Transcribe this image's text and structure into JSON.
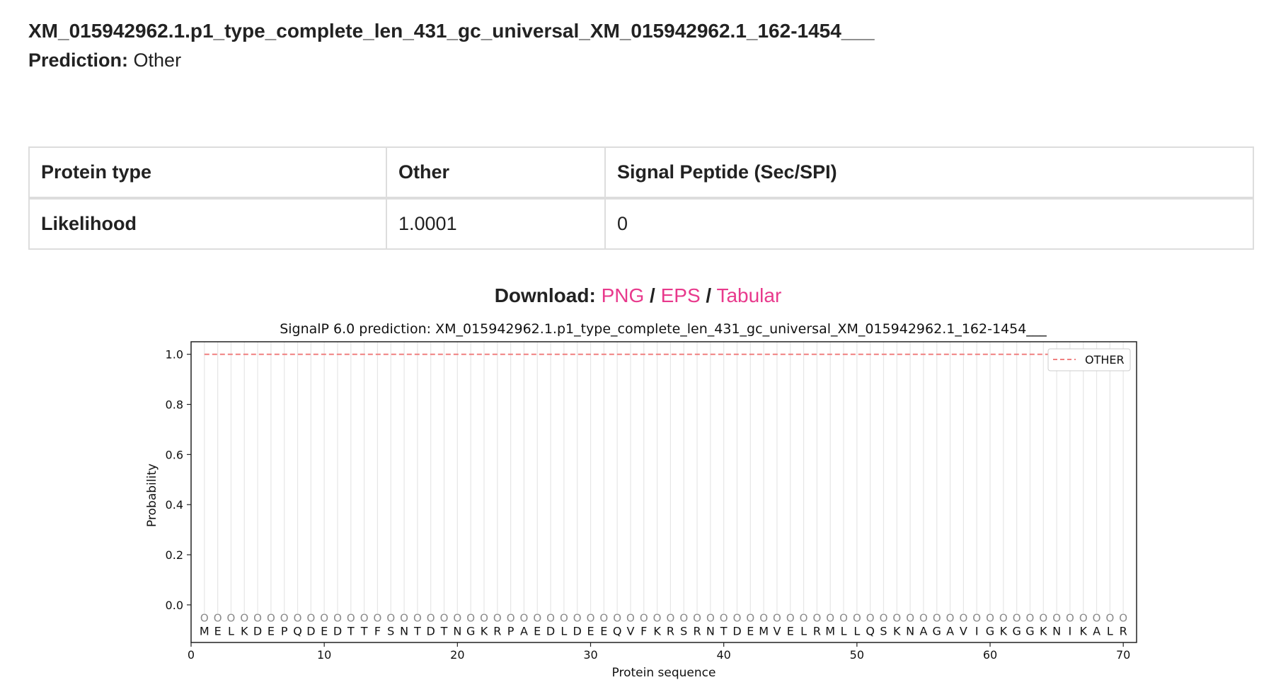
{
  "header": {
    "sequence_title": "XM_015942962.1.p1_type_complete_len_431_gc_universal_XM_015942962.1_162-1454___",
    "prediction_label": "Prediction:",
    "prediction_value": "Other"
  },
  "results_table": {
    "rows": [
      {
        "label": "Protein type",
        "col1": "Other",
        "col2": "Signal Peptide (Sec/SPI)"
      },
      {
        "label": "Likelihood",
        "col1": "1.0001",
        "col2": "0"
      }
    ]
  },
  "download": {
    "label": "Download:",
    "separator": "/",
    "links": [
      "PNG",
      "EPS",
      "Tabular"
    ]
  },
  "colors": {
    "link": "#e8398c",
    "other_series": "#f08080",
    "border": "#dddddd"
  },
  "chart_data": {
    "type": "line",
    "title": "SignalP 6.0 prediction: XM_015942962.1.p1_type_complete_len_431_gc_universal_XM_015942962.1_162-1454___",
    "xlabel": "Protein sequence",
    "ylabel": "Probability",
    "xlim": [
      0,
      71
    ],
    "ylim": [
      -0.15,
      1.05
    ],
    "xticks": [
      0,
      10,
      20,
      30,
      40,
      50,
      60,
      70
    ],
    "yticks": [
      0.0,
      0.2,
      0.4,
      0.6,
      0.8,
      1.0
    ],
    "ytick_labels": [
      "0.0",
      "0.2",
      "0.4",
      "0.6",
      "0.8",
      "1.0"
    ],
    "legend_position": "top-right",
    "sequence": "MELKDEPQDEDTTFSNTDTNGKRPAEDLDEEQVFKRSRNTDEMVELRMLLQSKNAGAVIGKGGKNIKALR",
    "region_marker": "O",
    "series": [
      {
        "name": "OTHER",
        "style": "dashed",
        "x_range": [
          1,
          70
        ],
        "value": 1.0
      }
    ]
  }
}
